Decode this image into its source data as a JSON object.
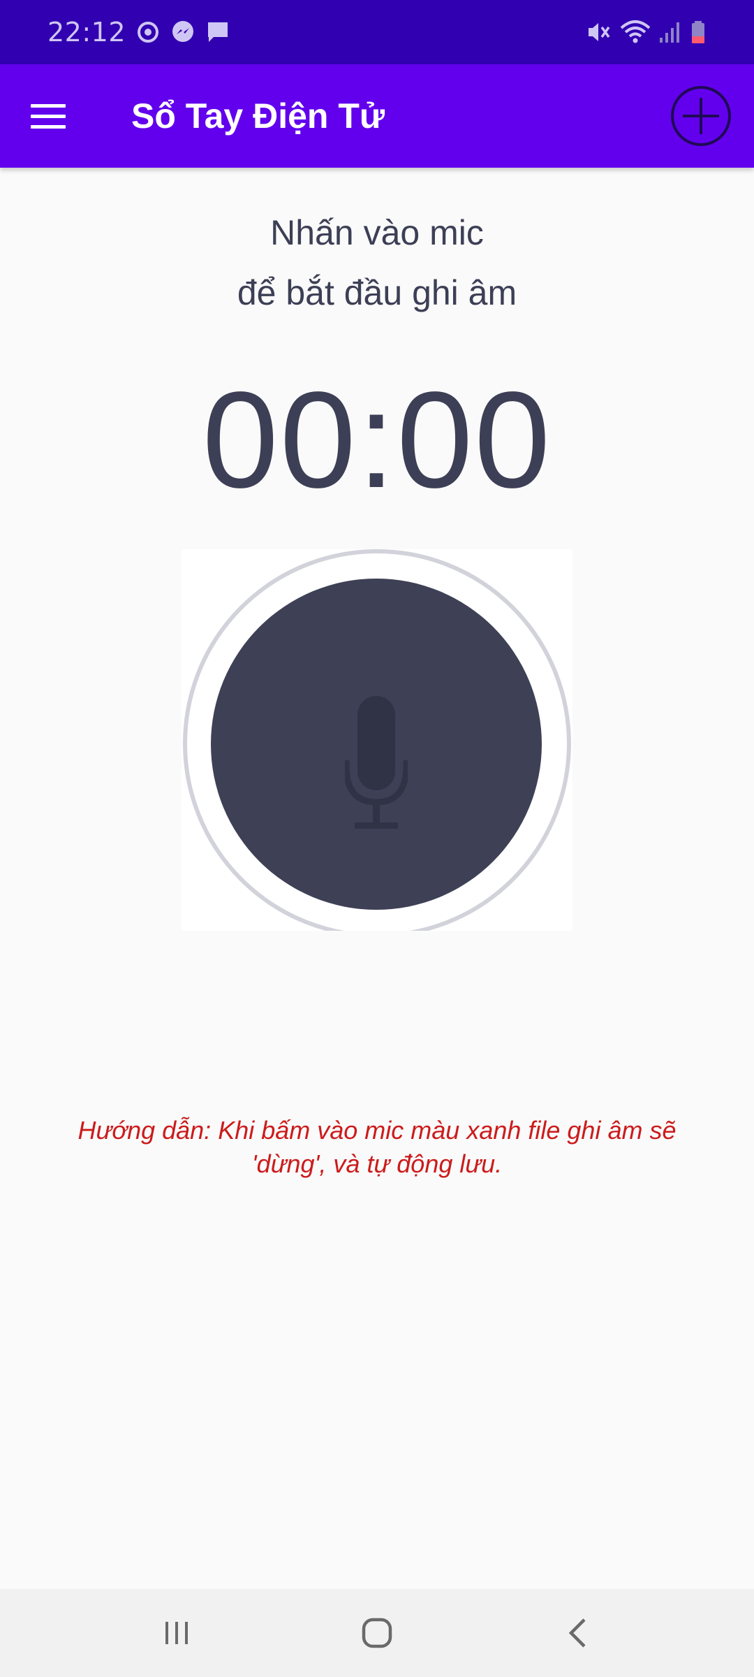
{
  "status_bar": {
    "time": "22:12",
    "left_icons": [
      "sync-icon",
      "messenger-icon",
      "chat-icon"
    ],
    "right_icons": [
      "mute-icon",
      "wifi-icon",
      "signal-icon",
      "battery-icon"
    ]
  },
  "app_bar": {
    "title": "Sổ Tay Điện Tử",
    "menu_icon": "hamburger-menu-icon",
    "add_icon": "plus-circle-icon"
  },
  "recorder": {
    "prompt_line1": "Nhấn vào mic",
    "prompt_line2": "để bắt đầu ghi âm",
    "timer": "00:00",
    "mic_icon": "microphone-icon"
  },
  "instructions": {
    "line1": "Hướng dẫn: Khi bấm vào mic màu xanh file ghi âm sẽ",
    "line2": "'dừng', và tự động lưu."
  },
  "nav_bar": {
    "buttons": [
      "recent-apps-icon",
      "home-icon",
      "back-icon"
    ]
  },
  "colors": {
    "status_bar": "#3100b0",
    "app_bar": "#6200ee",
    "text_dark": "#3c3f55",
    "mic_fill": "#3e4056",
    "instruction_text": "#cc1b1b",
    "background": "#fafafa"
  }
}
